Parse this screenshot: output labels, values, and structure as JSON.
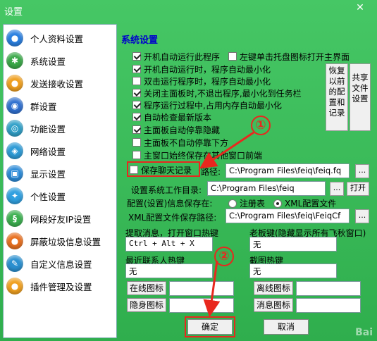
{
  "window": {
    "title": "设置"
  },
  "sidebar": {
    "items": [
      {
        "label": "个人资料设置",
        "icon": "person-icon",
        "color": "#2a7fe0"
      },
      {
        "label": "系统设置",
        "icon": "gear-icon",
        "color": "#3aa848"
      },
      {
        "label": "发送接收设置",
        "icon": "send-icon",
        "color": "#f0a020"
      },
      {
        "label": "群设置",
        "icon": "globe-icon",
        "color": "#3070d0"
      },
      {
        "label": "功能设置",
        "icon": "function-icon",
        "color": "#30a0c8"
      },
      {
        "label": "网络设置",
        "icon": "network-icon",
        "color": "#2e9bd6"
      },
      {
        "label": "显示设置",
        "icon": "display-icon",
        "color": "#2a8ad8"
      },
      {
        "label": "个性设置",
        "icon": "star-icon",
        "color": "#30a0e0"
      },
      {
        "label": "网段好友IP设置",
        "icon": "ip-icon",
        "color": "#3cb050"
      },
      {
        "label": "屏蔽垃圾信息设置",
        "icon": "shield-icon",
        "color": "#e87020"
      },
      {
        "label": "自定义信息设置",
        "icon": "custom-icon",
        "color": "#2a90d0"
      },
      {
        "label": "插件管理及设置",
        "icon": "plugin-icon",
        "color": "#f0a020"
      }
    ]
  },
  "system": {
    "section_title": "系统设置",
    "checkboxes": [
      {
        "label": "开机自动运行此程序",
        "checked": true
      },
      {
        "label": "左键单击托盘图标打开主界面",
        "checked": false
      },
      {
        "label": "开机自动运行时，程序自动最小化",
        "checked": true
      },
      {
        "label": "双击运行程序时，程序自动最小化",
        "checked": false
      },
      {
        "label": "关闭主面板时,不退出程序,最小化到任务栏",
        "checked": true
      },
      {
        "label": "程序运行过程中,占用内存自动最小化",
        "checked": true
      },
      {
        "label": "自动检查最新版本",
        "checked": true
      },
      {
        "label": "主面板自动停靠隐藏",
        "checked": true
      },
      {
        "label": "主面板不自动停靠下方",
        "checked": false
      },
      {
        "label": "主窗口始终保存在其他窗口前端",
        "checked": false
      },
      {
        "label": "保存聊天记录",
        "checked": false
      }
    ],
    "restore_btn": [
      "恢复",
      "以前",
      "的配",
      "置和",
      "记录"
    ],
    "share_btn": [
      "共享",
      "文件",
      "设置"
    ],
    "chat_path_label": "路径:",
    "chat_path_value": "C:\\Program Files\\feiq\\feiq.fq",
    "browse": "...",
    "workdir_label": "设置系统工作目录:",
    "workdir_value": "C:\\Program Files\\feiq",
    "open_btn": "打开",
    "config_label": "配置(设置)信息保存在:",
    "radio_registry": "注册表",
    "radio_xml": "XML配置文件",
    "xml_path_label": "XML配置文件保存路径:",
    "xml_path_value": "C:\\Program Files\\feiq\\FeiqCf",
    "hotkey_msg_label": "提取消息，打开窗口热键",
    "hotkey_msg_value": "Ctrl + Alt + X",
    "boss_key_label": "老板键(隐藏显示所有飞秋窗口)",
    "boss_key_value": "无",
    "recent_label": "最近联系人热键",
    "recent_value": "无",
    "capture_label": "截图热键",
    "capture_value": "无",
    "online_icon_btn": "在线图标",
    "offline_icon_btn": "离线图标",
    "hidden_icon_btn": "隐身图标",
    "message_icon_btn": "消息图标",
    "ok_btn": "确定",
    "cancel_btn": "取消"
  },
  "annotations": {
    "one": "①",
    "two": "②"
  },
  "watermark": "Bai"
}
